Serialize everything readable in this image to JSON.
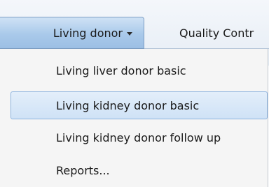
{
  "navbar": {
    "tabs": [
      {
        "label": "Living donor",
        "state": "open"
      },
      {
        "label": "Quality Contr"
      }
    ]
  },
  "menu": {
    "items": [
      {
        "label": "Living liver donor basic"
      },
      {
        "label": "Living kidney donor basic",
        "state": "hover"
      },
      {
        "label": "Living kidney donor follow up"
      },
      {
        "label": "Reports..."
      }
    ]
  },
  "colors": {
    "active_tab": "#a9c9ea",
    "hover_item": "#cfe2f6",
    "menu_background": "#f5f5f5"
  }
}
